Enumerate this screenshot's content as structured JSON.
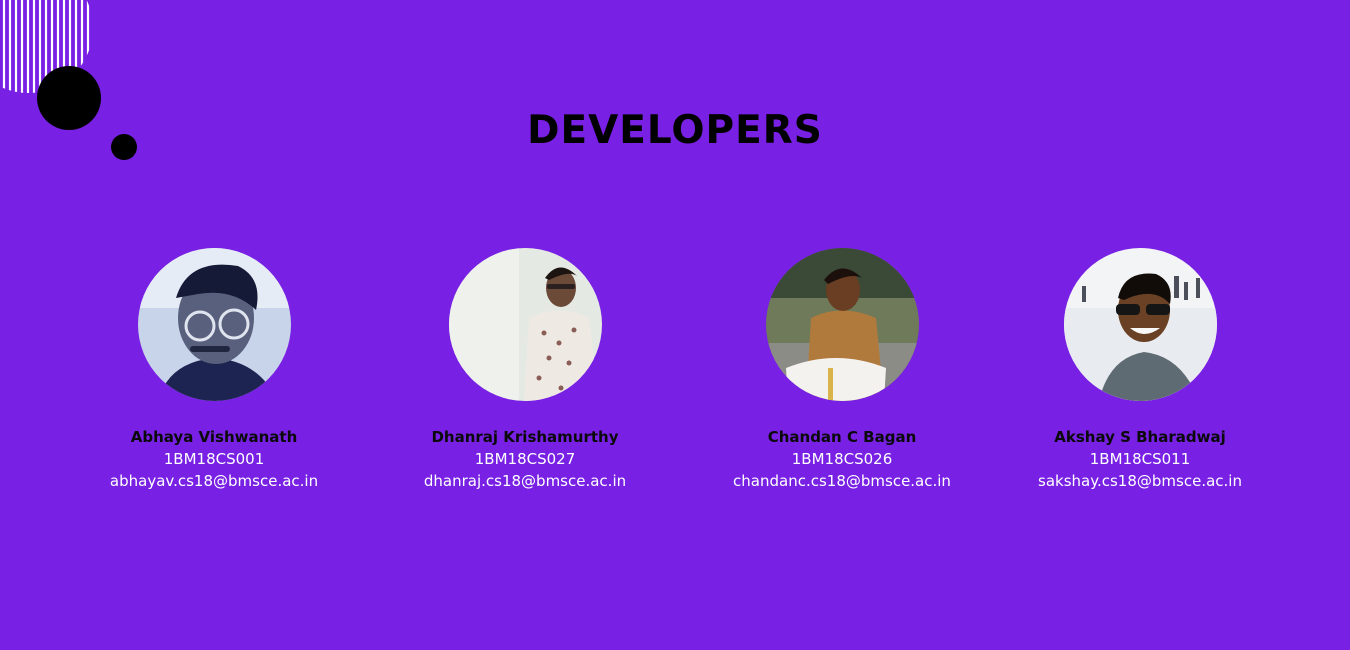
{
  "page": {
    "title": "DEVELOPERS"
  },
  "colors": {
    "background": "#7820e3",
    "name_text": "#0a0a0a",
    "info_text": "#ffffff"
  },
  "developers": [
    {
      "name": "Abhaya Vishwanath",
      "usn": "1BM18CS001",
      "email": "abhayav.cs18@bmsce.ac.in"
    },
    {
      "name": "Dhanraj Krishamurthy",
      "usn": "1BM18CS027",
      "email": "dhanraj.cs18@bmsce.ac.in"
    },
    {
      "name": "Chandan C Bagan",
      "usn": "1BM18CS026",
      "email": "chandanc.cs18@bmsce.ac.in"
    },
    {
      "name": "Akshay S Bharadwaj",
      "usn": "1BM18CS011",
      "email": "sakshay.cs18@bmsce.ac.in"
    }
  ]
}
